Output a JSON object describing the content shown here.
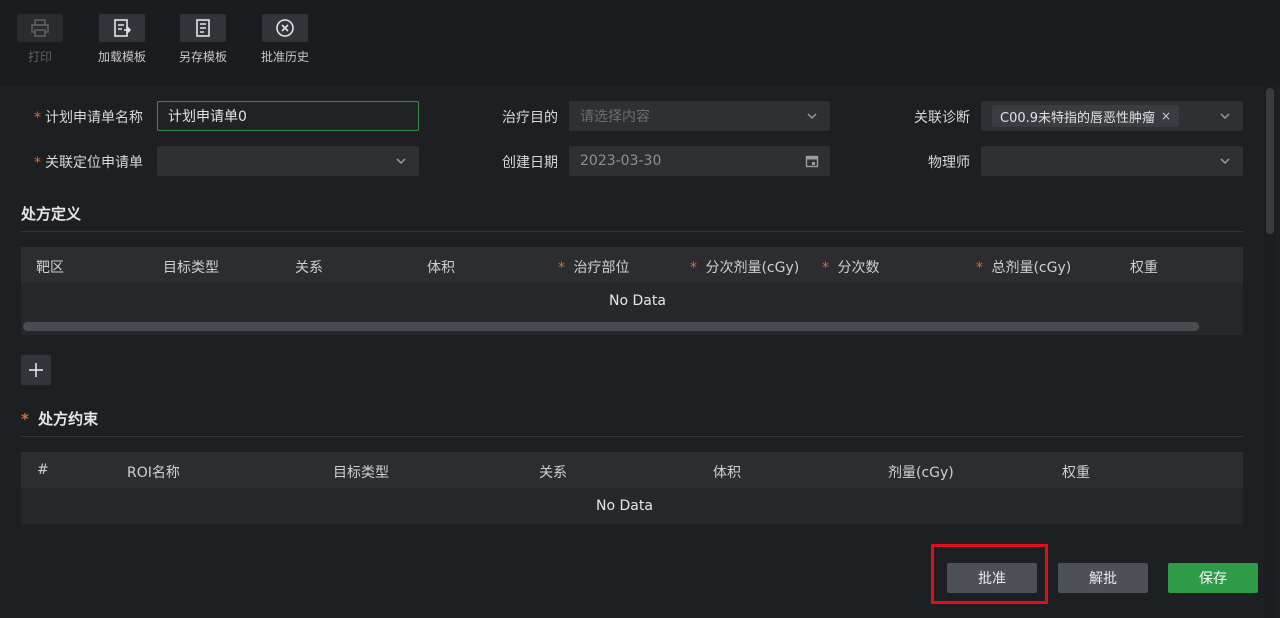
{
  "toolbar": {
    "print_label": "打印",
    "load_template_label": "加载模板",
    "save_as_template_label": "另存模板",
    "approval_history_label": "批准历史"
  },
  "form": {
    "plan_name_label": "计划申请单名称",
    "plan_name_value": "计划申请单0",
    "treatment_purpose_label": "治疗目的",
    "treatment_purpose_placeholder": "请选择内容",
    "related_diagnosis_label": "关联诊断",
    "related_diagnosis_tag": "C00.9未特指的唇恶性肿瘤",
    "related_location_label": "关联定位申请单",
    "related_location_value": "",
    "create_date_label": "创建日期",
    "create_date_value": "2023-03-30",
    "physicist_label": "物理师",
    "physicist_value": ""
  },
  "prescription_definition": {
    "title": "处方定义",
    "columns": [
      "靶区",
      "目标类型",
      "关系",
      "体积",
      "治疗部位",
      "分次剂量(cGy)",
      "分次数",
      "总剂量(cGy)",
      "权重"
    ],
    "required_columns": [
      "治疗部位",
      "分次剂量(cGy)",
      "分次数",
      "总剂量(cGy)"
    ],
    "empty_text": "No Data"
  },
  "prescription_constraints": {
    "title": "处方约束",
    "columns": [
      "#",
      "ROI名称",
      "目标类型",
      "关系",
      "体积",
      "剂量(cGy)",
      "权重"
    ],
    "empty_text": "No Data"
  },
  "actions": {
    "approve_label": "批准",
    "unapprove_label": "解批",
    "save_label": "保存"
  },
  "colors": {
    "required_star": "#e06c2c",
    "save_button": "#2e9b49",
    "highlight_box": "#e0101a"
  }
}
